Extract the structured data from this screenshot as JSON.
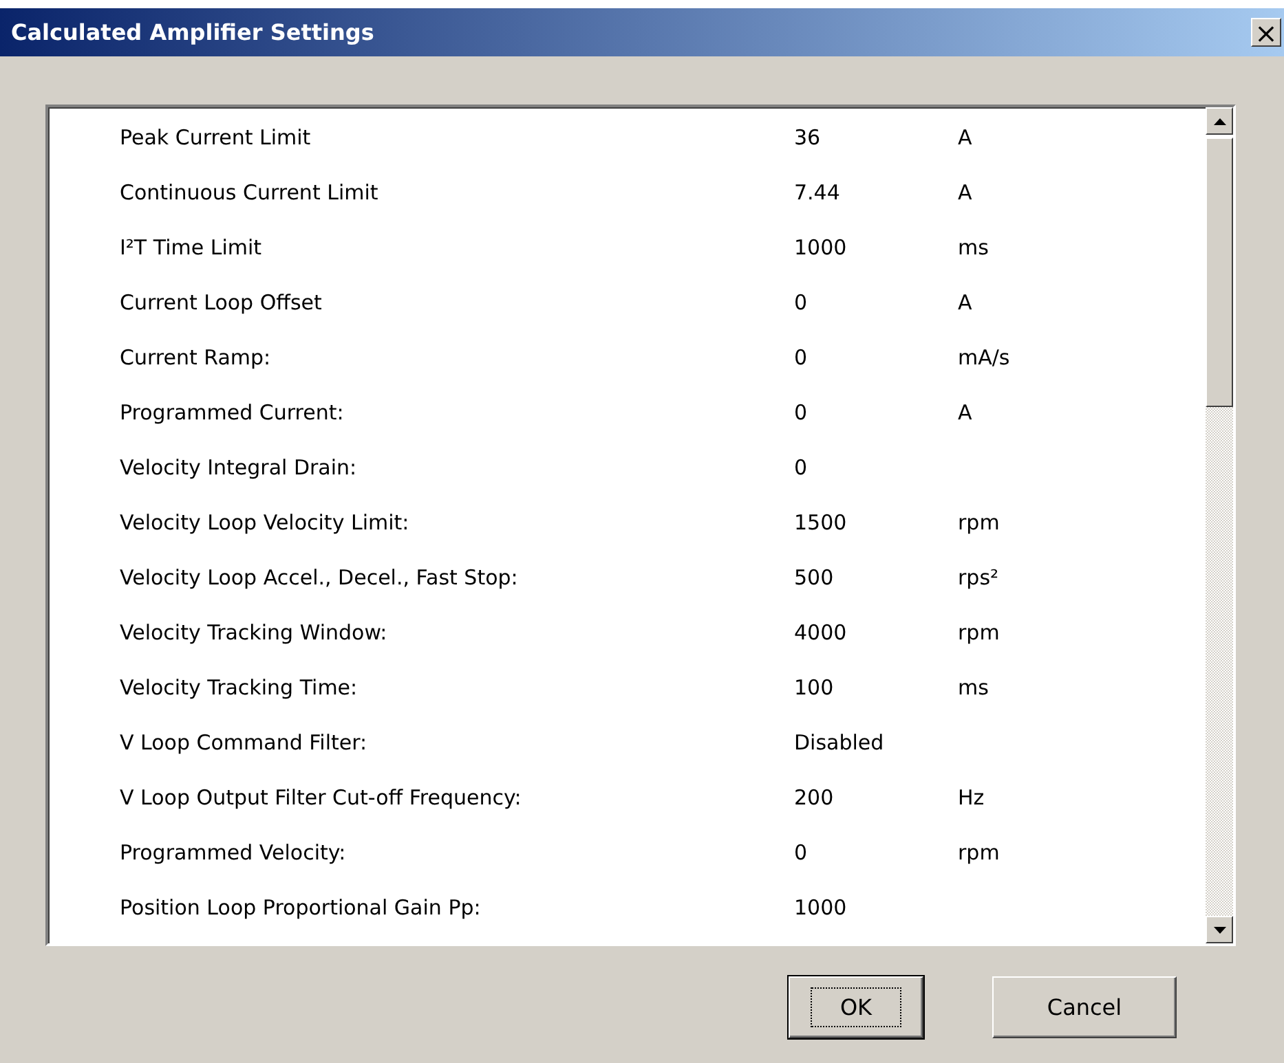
{
  "window": {
    "title": "Calculated Amplifier Settings",
    "close": "×"
  },
  "settings": [
    {
      "label": "Peak Current Limit",
      "value": "36",
      "unit": "A"
    },
    {
      "label": "Continuous Current Limit",
      "value": "7.44",
      "unit": "A"
    },
    {
      "label": "I²T Time Limit",
      "value": "1000",
      "unit": "ms"
    },
    {
      "label": "Current Loop Offset",
      "value": "0",
      "unit": "A"
    },
    {
      "label": "Current Ramp:",
      "value": "0",
      "unit": "mA/s"
    },
    {
      "label": "Programmed Current:",
      "value": "0",
      "unit": "A"
    },
    {
      "label": "Velocity Integral Drain:",
      "value": "0"
    },
    {
      "label": "Velocity Loop Velocity Limit:",
      "value": "1500",
      "unit": "rpm"
    },
    {
      "label": "Velocity Loop Accel., Decel., Fast Stop:",
      "value": "500",
      "unit": "rps²"
    },
    {
      "label": "Velocity Tracking Window:",
      "value": "4000",
      "unit": "rpm"
    },
    {
      "label": "Velocity Tracking Time:",
      "value": "100",
      "unit": "ms"
    },
    {
      "label": "V Loop Command Filter:",
      "value": "Disabled"
    },
    {
      "label": "V Loop Output Filter Cut-off Frequency:",
      "value": "200",
      "unit": "Hz"
    },
    {
      "label": "Programmed Velocity:",
      "value": "0",
      "unit": "rpm"
    },
    {
      "label": "Position Loop Proportional Gain Pp:",
      "value": "1000"
    }
  ],
  "buttons": [
    {
      "label": "OK",
      "focused": true
    },
    {
      "label": "Cancel",
      "focused": false
    }
  ]
}
